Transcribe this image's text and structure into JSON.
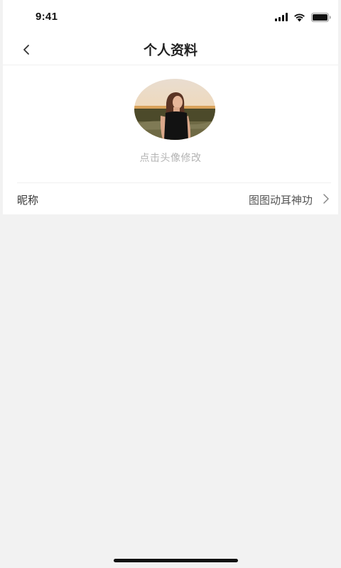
{
  "status_bar": {
    "time": "9:41"
  },
  "nav": {
    "title": "个人资料"
  },
  "avatar": {
    "hint": "点击头像修改"
  },
  "profile": {
    "nickname_label": "昵称",
    "nickname_value": "图图动耳神功"
  },
  "icons": {
    "back": "chevron-left-icon",
    "row_arrow": "chevron-right-icon",
    "signal": "cellular-signal-icon",
    "wifi": "wifi-icon",
    "battery": "battery-icon"
  },
  "colors": {
    "page_background": "#f2f2f2",
    "card_background": "#ffffff",
    "title_text": "#222222",
    "hint_text": "#b3b3b3"
  }
}
